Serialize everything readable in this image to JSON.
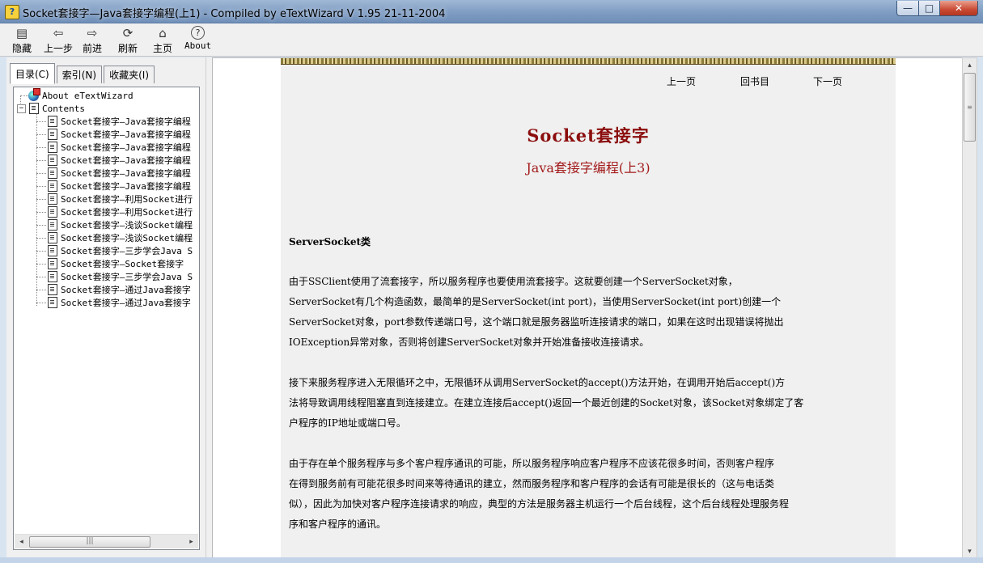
{
  "window": {
    "title": "Socket套接字—Java套接字编程(上1)   - Compiled by eTextWizard V 1.95     21-11-2004",
    "min_glyph": "—",
    "max_glyph": "□",
    "close_glyph": "✕"
  },
  "toolbar": {
    "buttons": [
      {
        "label": "隐藏",
        "icon": "▤"
      },
      {
        "label": "上一步",
        "icon": "⇦"
      },
      {
        "label": "前进",
        "icon": "⇨"
      },
      {
        "label": "刷新",
        "icon": "⟳"
      },
      {
        "label": "主页",
        "icon": "⌂"
      },
      {
        "label": "About",
        "icon": "?"
      }
    ]
  },
  "left_pane": {
    "tabs": [
      "目录(C)",
      "索引(N)",
      "收藏夹(I)"
    ],
    "tree": {
      "about": "About eTextWizard",
      "contents": "Contents",
      "expander": "−",
      "items": [
        "Socket套接字—Java套接字编程",
        "Socket套接字—Java套接字编程",
        "Socket套接字—Java套接字编程",
        "Socket套接字—Java套接字编程",
        "Socket套接字—Java套接字编程",
        "Socket套接字—Java套接字编程",
        "Socket套接字—利用Socket进行",
        "Socket套接字—利用Socket进行",
        "Socket套接字—浅谈Socket编程",
        "Socket套接字—浅谈Socket编程",
        "Socket套接字—三步学会Java S",
        "Socket套接字—Socket套接字",
        "Socket套接字—三步学会Java S",
        "Socket套接字—通过Java套接字",
        "Socket套接字—通过Java套接字"
      ]
    },
    "hscroll": {
      "left": "◂",
      "right": "▸",
      "thumb": "|||"
    }
  },
  "content": {
    "nav": {
      "prev": "上一页",
      "home": "回书目",
      "next": "下一页"
    },
    "title": "Socket套接字",
    "subtitle": "Java套接字编程(上3)",
    "section_title": "ServerSocket类",
    "paragraphs": [
      [
        "    由于SSClient使用了流套接字，所以服务程序也要使用流套接字。这就要创建一个ServerSocket对象，",
        "ServerSocket有几个构造函数，最简单的是ServerSocket(int port)，当使用ServerSocket(int port)创建一个",
        "ServerSocket对象，port参数传递端口号，这个端口就是服务器监听连接请求的端口，如果在这时出现错误将抛出",
        "IOException异常对象，否则将创建ServerSocket对象并开始准备接收连接请求。"
      ],
      [
        "    接下来服务程序进入无限循环之中，无限循环从调用ServerSocket的accept()方法开始，在调用开始后accept()方",
        "法将导致调用线程阻塞直到连接建立。在建立连接后accept()返回一个最近创建的Socket对象，该Socket对象绑定了客",
        "户程序的IP地址或端口号。"
      ],
      [
        "    由于存在单个服务程序与多个客户程序通讯的可能，所以服务程序响应客户程序不应该花很多时间，否则客户程序",
        "在得到服务前有可能花很多时间来等待通讯的建立，然而服务程序和客户程序的会话有可能是很长的（这与电话类",
        "似），因此为加快对客户程序连接请求的响应，典型的方法是服务器主机运行一个后台线程，这个后台线程处理服务程",
        "序和客户程序的通讯。"
      ]
    ]
  },
  "vscroll": {
    "up": "▴",
    "down": "▾",
    "thumb": "≡"
  }
}
